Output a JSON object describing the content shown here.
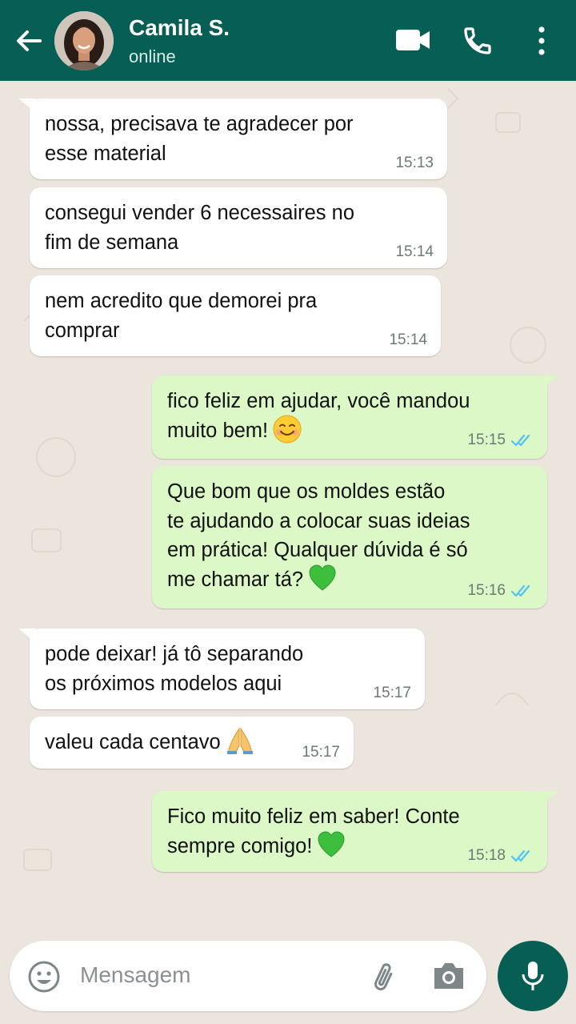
{
  "header": {
    "contact_name": "Camila S.",
    "status": "online",
    "icons": [
      "back-arrow-icon",
      "video-call-icon",
      "phone-icon",
      "more-options-icon"
    ],
    "bg_color": "#075E54"
  },
  "messages": [
    {
      "direction": "in",
      "lines": [
        "nossa, precisava te agradecer por",
        "esse material"
      ],
      "time": "15:13"
    },
    {
      "direction": "in",
      "lines": [
        "consegui vender 6 necessaires no",
        "fim de semana"
      ],
      "time": "15:14"
    },
    {
      "direction": "in",
      "lines": [
        "nem acredito que demorei pra",
        "comprar"
      ],
      "time": "15:14"
    },
    {
      "direction": "out",
      "lines": [
        "fico feliz em ajudar, você mandou",
        "muito bem!"
      ],
      "emoji": "smiling-face-emoji",
      "time": "15:15",
      "status": "read"
    },
    {
      "direction": "out",
      "lines": [
        "Que bom que os moldes estão",
        "te ajudando a colocar suas ideias",
        "em prática! Qualquer dúvida é só",
        "me chamar tá?"
      ],
      "emoji": "green-heart-emoji",
      "time": "15:16",
      "status": "read"
    },
    {
      "direction": "in",
      "lines": [
        "pode deixar! já tô separando",
        "os próximos modelos aqui"
      ],
      "time": "15:17"
    },
    {
      "direction": "in",
      "lines": [
        "valeu cada centavo"
      ],
      "emoji": "folded-hands-emoji",
      "time": "15:17"
    },
    {
      "direction": "out",
      "lines": [
        "Fico muito feliz em saber! Conte",
        "sempre comigo!"
      ],
      "emoji": "green-heart-emoji",
      "time": "15:18",
      "status": "read"
    }
  ],
  "composer": {
    "placeholder": "Mensagem",
    "icons": [
      "emoji-icon",
      "attach-icon",
      "camera-icon",
      "mic-icon"
    ]
  },
  "colors": {
    "outgoing_bubble": "#DCF8C6",
    "incoming_bubble": "#FFFFFF",
    "read_ticks": "#4FC3F7",
    "chat_background": "#ECE5DD"
  }
}
